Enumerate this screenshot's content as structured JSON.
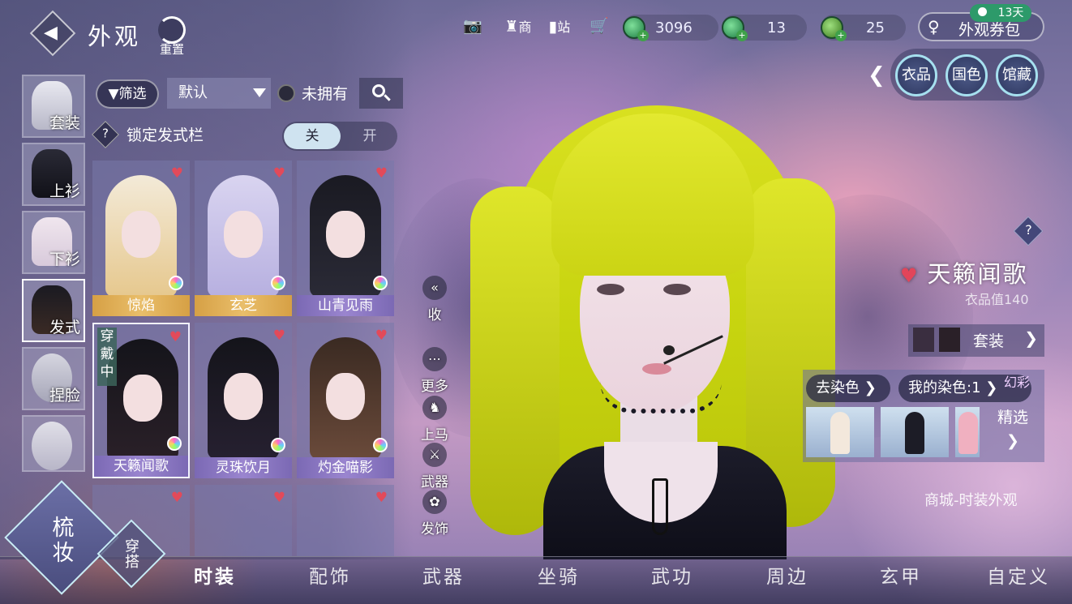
{
  "header": {
    "title": "外观",
    "reset_label": "重置",
    "icons": [
      {
        "name": "camera-icon",
        "label": ""
      },
      {
        "name": "shop-icon",
        "label": "商"
      },
      {
        "name": "station-icon",
        "label": "站"
      },
      {
        "name": "cart-icon",
        "label": ""
      }
    ],
    "currencies": [
      {
        "name": "jade-coin",
        "amount": "3096"
      },
      {
        "name": "green-coin",
        "amount": "13"
      },
      {
        "name": "gold-coin",
        "amount": "25"
      }
    ],
    "voucher": {
      "label": "外观券包",
      "days": "13天"
    }
  },
  "right_buttons": [
    "衣品",
    "国色",
    "馆藏"
  ],
  "filter": {
    "filter_label": "筛选",
    "sort_value": "默认",
    "unowned_label": "未拥有",
    "lock_label": "锁定发式栏",
    "switch_off": "关",
    "switch_on": "开"
  },
  "categories": [
    {
      "label": "套装",
      "selected": false
    },
    {
      "label": "上衫",
      "selected": false
    },
    {
      "label": "下衫",
      "selected": false
    },
    {
      "label": "发式",
      "selected": true
    },
    {
      "label": "捏脸",
      "selected": false
    },
    {
      "label": "",
      "selected": false
    }
  ],
  "items": [
    {
      "name": "惊焰",
      "tier": "gold",
      "favorite": true,
      "dye": true,
      "wearing": false
    },
    {
      "name": "玄芝",
      "tier": "gold",
      "favorite": true,
      "dye": true,
      "wearing": false
    },
    {
      "name": "山青见雨",
      "tier": "purple",
      "favorite": true,
      "dye": true,
      "wearing": false
    },
    {
      "name": "天籁闻歌",
      "tier": "purple",
      "favorite": true,
      "dye": true,
      "wearing": true
    },
    {
      "name": "灵珠饮月",
      "tier": "purple",
      "favorite": true,
      "dye": true,
      "wearing": false
    },
    {
      "name": "灼金喵影",
      "tier": "purple",
      "favorite": true,
      "dye": true,
      "wearing": false
    }
  ],
  "wearing_label": "穿戴中",
  "side_actions": [
    "收",
    "更多",
    "上马",
    "武器",
    "发饰"
  ],
  "detail": {
    "name": "天籁闻歌",
    "value_label": "衣品值140",
    "set_label": "套装",
    "undye_label": "去染色",
    "my_dye_label": "我的染色:1",
    "iridescent_label": "幻彩",
    "refine_label": "精选",
    "shop_link": "商城-时装外观"
  },
  "mode_buttons": {
    "primary": "梳妆",
    "secondary": "穿搭"
  },
  "bottom_tabs": [
    {
      "label": "时装",
      "selected": true
    },
    {
      "label": "配饰",
      "selected": false
    },
    {
      "label": "武器",
      "selected": false
    },
    {
      "label": "坐骑",
      "selected": false
    },
    {
      "label": "武功",
      "selected": false
    },
    {
      "label": "周边",
      "selected": false
    },
    {
      "label": "玄甲",
      "selected": false
    },
    {
      "label": "自定义",
      "selected": false
    }
  ],
  "colors": {
    "hair_accent": "#d4dc18",
    "gold_tier": "#e0b35a",
    "purple_tier": "#8a76c2",
    "switch_active": "#cfe3f0",
    "favorite": "#e2455a"
  }
}
